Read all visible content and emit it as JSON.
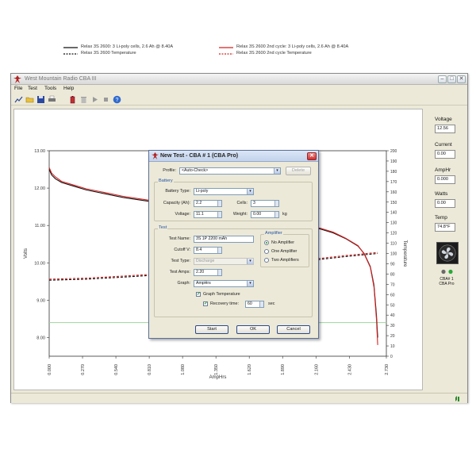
{
  "window": {
    "title": "West Mountain Radio CBA III",
    "controls": [
      "–",
      "□",
      "✕"
    ]
  },
  "menu": [
    "File",
    "Test",
    "Tools",
    "Help"
  ],
  "toolbar": {
    "icons": [
      "graph-icon",
      "open-folder-icon",
      "save-icon",
      "print-icon",
      "battery-icon",
      "trash-icon",
      "play-icon",
      "stop-icon",
      "help-icon"
    ]
  },
  "legend": [
    {
      "label": "Relax 3S 2600: 3 Li-poly cells, 2.6 Ah @ 8.40A",
      "color": "#111111",
      "style": "solid"
    },
    {
      "label": "Relax 3S 2600 Temperature",
      "color": "#111111",
      "style": "dashed"
    },
    {
      "label": "Relax 3S 2600 2nd cycle: 3 Li-poly cells, 2.6 Ah @ 8.40A",
      "color": "#d62020",
      "style": "solid"
    },
    {
      "label": "Relax 3S 2600 2nd cycle Temperature",
      "color": "#d62020",
      "style": "dashed"
    }
  ],
  "chart_data": {
    "type": "line",
    "xlabel": "AmpHrs",
    "ylabel": "Volts",
    "y2label": "Temperature",
    "x_ticks": [
      "0.000",
      "0.270",
      "0.540",
      "0.810",
      "1.080",
      "1.350",
      "1.620",
      "1.890",
      "2.160",
      "2.430",
      "2.730"
    ],
    "y_ticks": [
      "13.00",
      "12.00",
      "11.00",
      "10.00",
      "9.00",
      "8.00"
    ],
    "y2_ticks": [
      "200",
      "190",
      "180",
      "170",
      "160",
      "150",
      "140",
      "130",
      "120",
      "110",
      "100",
      "90",
      "80",
      "70",
      "60",
      "50",
      "40",
      "30",
      "20",
      "10",
      "0"
    ],
    "xlim": [
      0,
      2.73
    ],
    "ylim": [
      7.5,
      13.0
    ],
    "y2lim": [
      0,
      200
    ],
    "cutoff_line": 8.4,
    "series": [
      {
        "name": "Relax 3S 2600: 3 Li-poly cells, 2.6 Ah @ 8.40A",
        "axis": "left",
        "color": "#111111",
        "dash": false,
        "x": [
          0.0,
          0.02,
          0.05,
          0.1,
          0.2,
          0.3,
          0.45,
          0.6,
          0.8,
          1.0,
          1.2,
          1.5,
          1.8,
          2.0,
          2.1,
          2.2,
          2.3,
          2.4,
          2.5,
          2.55,
          2.6,
          2.63,
          2.65,
          2.66
        ],
        "y": [
          12.5,
          12.35,
          12.25,
          12.15,
          12.05,
          11.95,
          11.85,
          11.75,
          11.65,
          11.55,
          11.45,
          11.3,
          11.15,
          11.05,
          10.98,
          10.9,
          10.8,
          10.65,
          10.45,
          10.25,
          9.9,
          9.4,
          8.6,
          8.0
        ]
      },
      {
        "name": "Relax 3S 2600 2nd cycle: 3 Li-poly cells, 2.6 Ah @ 8.40A",
        "axis": "left",
        "color": "#d62020",
        "dash": false,
        "x": [
          0.0,
          0.02,
          0.05,
          0.1,
          0.2,
          0.3,
          0.45,
          0.6,
          0.8,
          1.0,
          1.2,
          1.5,
          1.8,
          2.0,
          2.1,
          2.2,
          2.3,
          2.4,
          2.5,
          2.55,
          2.6,
          2.63,
          2.65,
          2.66
        ],
        "y": [
          12.55,
          12.4,
          12.3,
          12.18,
          12.08,
          11.98,
          11.88,
          11.78,
          11.68,
          11.58,
          11.48,
          11.32,
          11.17,
          11.07,
          11.0,
          10.92,
          10.82,
          10.66,
          10.46,
          10.24,
          9.88,
          9.35,
          8.5,
          7.8
        ]
      },
      {
        "name": "Relax 3S 2600 Temperature",
        "axis": "right",
        "color": "#111111",
        "dash": true,
        "x": [
          0.0,
          0.3,
          0.6,
          1.0,
          1.4,
          1.8,
          2.1,
          2.4,
          2.66
        ],
        "y": [
          74,
          75,
          77,
          80,
          84,
          89,
          93,
          97,
          100
        ]
      },
      {
        "name": "Relax 3S 2600 2nd cycle Temperature",
        "axis": "right",
        "color": "#d62020",
        "dash": true,
        "x": [
          0.0,
          0.3,
          0.6,
          1.0,
          1.4,
          1.8,
          2.1,
          2.4,
          2.66
        ],
        "y": [
          75,
          76,
          78,
          81,
          85,
          90,
          94,
          98,
          101
        ]
      }
    ]
  },
  "meters": [
    {
      "label": "Voltage",
      "value": "12.56"
    },
    {
      "label": "Current",
      "value": "0.00"
    },
    {
      "label": "AmpHr",
      "value": "0.000"
    },
    {
      "label": "Watts",
      "value": "0.00"
    },
    {
      "label": "Temp",
      "value": "74.8°F"
    }
  ],
  "device": {
    "line1": "CBA# 1",
    "line2": "CBA Pro"
  },
  "dialog": {
    "title": "New Test - CBA # 1 (CBA Pro)",
    "profile_label": "Profile:",
    "profile_value": "<Auto-Check>",
    "delete_label": "Delete",
    "battery_group": "Battery",
    "battery_type_label": "Battery Type:",
    "battery_type_value": "Li-poly",
    "capacity_label": "Capacity (Ah):",
    "capacity_value": "2.2",
    "cells_label": "Cells:",
    "cells_value": "3",
    "voltage_label": "Voltage:",
    "voltage_value": "11.1",
    "weight_label": "Weight:",
    "weight_value": "0.00",
    "weight_unit": "kg",
    "test_group": "Test",
    "test_name_label": "Test Name:",
    "test_name_value": "3S 1P 2200 mAh",
    "cutoff_label": "Cutoff V:",
    "cutoff_value": "8.4",
    "test_type_label": "Test Type:",
    "test_type_value": "Discharge",
    "test_amps_label": "Test Amps:",
    "test_amps_value": "2.20",
    "graph_label": "Graph:",
    "graph_value": "AmpHrs",
    "graph_temp_label": "Graph Temperature",
    "recovery_label": "Recovery time:",
    "recovery_value": "60",
    "recovery_unit": "sec",
    "amplifier_group": "Amplifier",
    "amp_options": [
      "No Amplifier",
      "One Amplifier",
      "Two Amplifiers"
    ],
    "start_label": "Start",
    "ok_label": "OK",
    "cancel_label": "Cancel"
  }
}
